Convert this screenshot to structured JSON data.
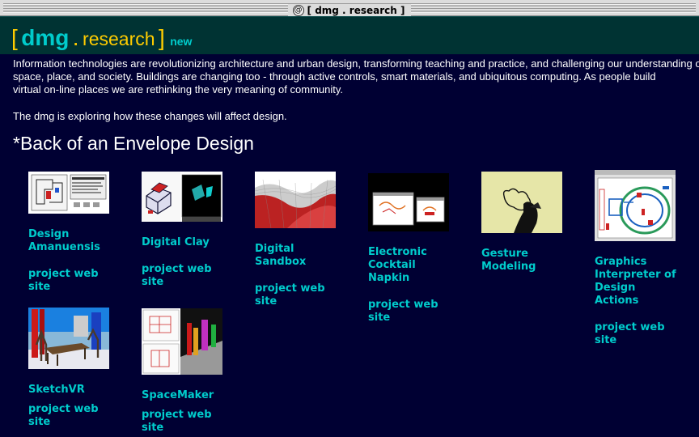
{
  "window": {
    "title": "[ dmg . research ]"
  },
  "header": {
    "bracket_open": "[",
    "brand": "dmg",
    "dot": ".",
    "section": "research",
    "bracket_close": "]",
    "new_label": "new"
  },
  "intro": {
    "line1": "Information technologies are revolutionizing architecture and urban design, transforming teaching and practice, and challenging our understanding of",
    "line2": "space, place, and society. Buildings are changing too - through active controls, smart materials, and ubiquitous computing. As people build",
    "line3": "virtual on-line places we are rethinking the very meaning of community.",
    "exploring": "The dmg is exploring how these changes will affect design."
  },
  "section_title": "*Back of an Envelope Design",
  "colors": {
    "background": "#000033",
    "header": "#003333",
    "accent": "#00cccc",
    "brand_yellow": "#ffcc00"
  },
  "projects": [
    {
      "name_lines": [
        "Design",
        "Amanuensis"
      ],
      "link_lines": [
        "project web",
        "site"
      ]
    },
    {
      "name_lines": [
        "Digital Clay"
      ],
      "link_lines": [
        "project web",
        "site"
      ]
    },
    {
      "name_lines": [
        "Digital",
        "Sandbox"
      ],
      "link_lines": [
        "project web",
        "site"
      ]
    },
    {
      "name_lines": [
        "Electronic",
        "Cocktail",
        "Napkin"
      ],
      "link_lines": [
        "project web",
        "site"
      ]
    },
    {
      "name_lines": [
        "Gesture",
        "Modeling"
      ]
    },
    {
      "name_lines": [
        "Graphics",
        "Interpreter of",
        "Design",
        "Actions"
      ],
      "link_lines": [
        "project web",
        "site"
      ]
    },
    {
      "name_lines": [
        "SketchVR"
      ],
      "link_lines": [
        "project web",
        "site"
      ]
    },
    {
      "name_lines": [
        "SpaceMaker"
      ],
      "link_lines": [
        "project web",
        "site"
      ]
    }
  ]
}
